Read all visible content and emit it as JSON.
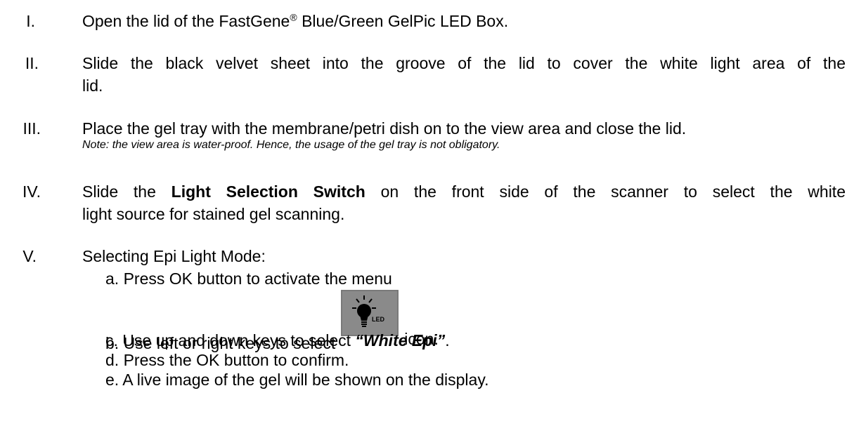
{
  "steps": [
    {
      "numeral": "I.",
      "text_a": "Open the lid of the FastGene",
      "sup": "®",
      "text_b": " Blue/Green GelPic LED Box."
    },
    {
      "numeral": "II.",
      "line1": "Slide the black velvet sheet into the groove of the lid to cover the white light area of the",
      "line2": "lid."
    },
    {
      "numeral": "III.",
      "text": "Place the gel tray with the membrane/petri dish on to the view area and close the lid.",
      "note": "Note: the view area is water-proof. Hence, the usage of the gel tray is not obligatory."
    },
    {
      "numeral": "IV.",
      "text_a": "Slide the ",
      "bold": "Light Selection Switch",
      "text_b": " on the front side of the scanner to select the white",
      "line2": "light source for stained gel scanning."
    },
    {
      "numeral": "V.",
      "text": "Selecting Epi Light Mode:"
    }
  ],
  "substeps": {
    "a": "a.  Press OK button to activate the menu",
    "b_pre": "b.  Use left or right keys to select",
    "b_post": "icon.",
    "c_pre": "c.  Use up and down keys to select ",
    "c_bold": "“White Epi”",
    "c_post": ".",
    "d": "d.  Press the OK button to confirm.",
    "e": "e.  A live image of the gel will be shown on the display."
  },
  "icon": {
    "name": "led-bulb-icon",
    "label": "LED",
    "bg": "#8a8a8a",
    "fg": "#000000"
  }
}
